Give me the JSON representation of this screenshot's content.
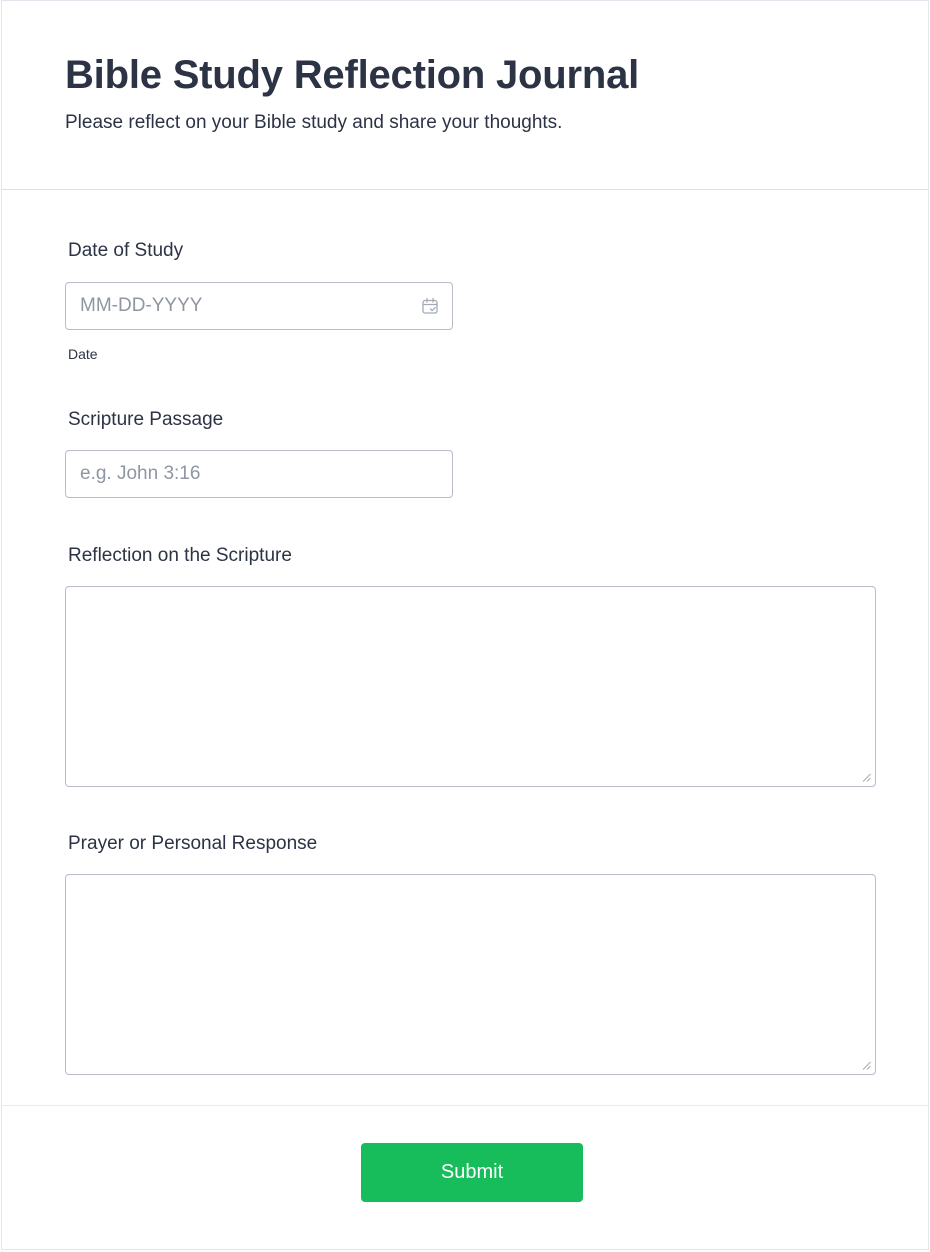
{
  "header": {
    "title": "Bible Study Reflection Journal",
    "subtitle": "Please reflect on your Bible study and share your thoughts."
  },
  "fields": {
    "date": {
      "label": "Date of Study",
      "placeholder": "MM-DD-YYYY",
      "value": "",
      "sublabel": "Date",
      "icon": "calendar-icon"
    },
    "scripture": {
      "label": "Scripture Passage",
      "placeholder": "e.g. John 3:16",
      "value": ""
    },
    "reflection": {
      "label": "Reflection on the Scripture",
      "value": ""
    },
    "prayer": {
      "label": "Prayer or Personal Response",
      "value": ""
    }
  },
  "actions": {
    "submit_label": "Submit"
  },
  "colors": {
    "submit_bg": "#18bd5b",
    "text": "#2c3345",
    "border": "#b8bdc9",
    "placeholder": "#8f96a3"
  }
}
